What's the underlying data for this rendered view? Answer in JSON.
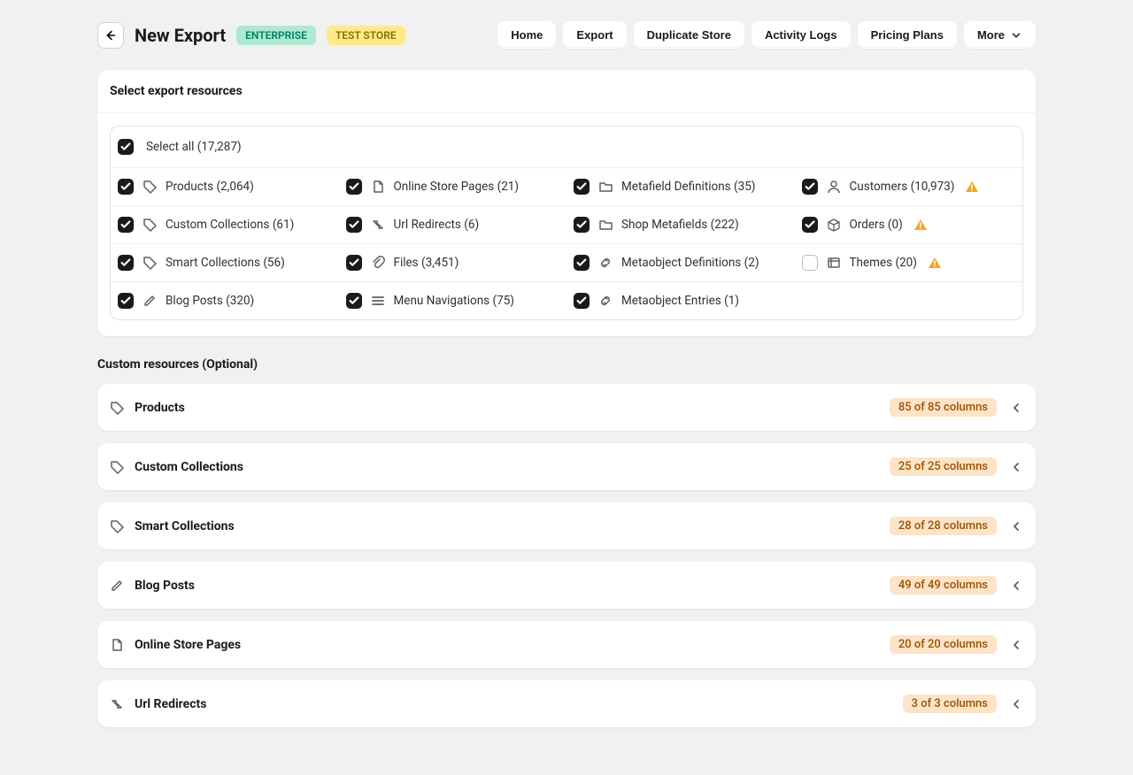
{
  "header": {
    "title": "New Export",
    "badge_enterprise": "ENTERPRISE",
    "badge_test": "TEST STORE",
    "nav": [
      "Home",
      "Export",
      "Duplicate Store",
      "Activity Logs",
      "Pricing Plans"
    ],
    "more": "More"
  },
  "select_panel": {
    "title": "Select export resources",
    "select_all": "Select all (17,287)",
    "rows": [
      [
        {
          "label": "Products (2,064)",
          "icon": "tag",
          "checked": true,
          "warn": false
        },
        {
          "label": "Online Store Pages (21)",
          "icon": "page",
          "checked": true,
          "warn": false
        },
        {
          "label": "Metafield Definitions (35)",
          "icon": "folder",
          "checked": true,
          "warn": false
        },
        {
          "label": "Customers (10,973)",
          "icon": "user",
          "checked": true,
          "warn": true
        }
      ],
      [
        {
          "label": "Custom Collections (61)",
          "icon": "tag",
          "checked": true,
          "warn": false
        },
        {
          "label": "Url Redirects (6)",
          "icon": "redirect",
          "checked": true,
          "warn": false
        },
        {
          "label": "Shop Metafields (222)",
          "icon": "folder",
          "checked": true,
          "warn": false
        },
        {
          "label": "Orders (0)",
          "icon": "box",
          "checked": true,
          "warn": true
        }
      ],
      [
        {
          "label": "Smart Collections (56)",
          "icon": "tag",
          "checked": true,
          "warn": false
        },
        {
          "label": "Files (3,451)",
          "icon": "attach",
          "checked": true,
          "warn": false
        },
        {
          "label": "Metaobject Definitions (2)",
          "icon": "link",
          "checked": true,
          "warn": false
        },
        {
          "label": "Themes (20)",
          "icon": "theme",
          "checked": false,
          "warn": true
        }
      ],
      [
        {
          "label": "Blog Posts (320)",
          "icon": "edit",
          "checked": true,
          "warn": false
        },
        {
          "label": "Menu Navigations (75)",
          "icon": "menu",
          "checked": true,
          "warn": false
        },
        {
          "label": "Metaobject Entries (1)",
          "icon": "link",
          "checked": true,
          "warn": false
        },
        null
      ]
    ]
  },
  "custom_resources": {
    "title": "Custom resources (Optional)",
    "items": [
      {
        "title": "Products",
        "icon": "tag",
        "badge": "85 of 85 columns"
      },
      {
        "title": "Custom Collections",
        "icon": "tag",
        "badge": "25 of 25 columns"
      },
      {
        "title": "Smart Collections",
        "icon": "tag",
        "badge": "28 of 28 columns"
      },
      {
        "title": "Blog Posts",
        "icon": "edit",
        "badge": "49 of 49 columns"
      },
      {
        "title": "Online Store Pages",
        "icon": "page",
        "badge": "20 of 20 columns"
      },
      {
        "title": "Url Redirects",
        "icon": "redirect",
        "badge": "3 of 3 columns"
      }
    ]
  }
}
